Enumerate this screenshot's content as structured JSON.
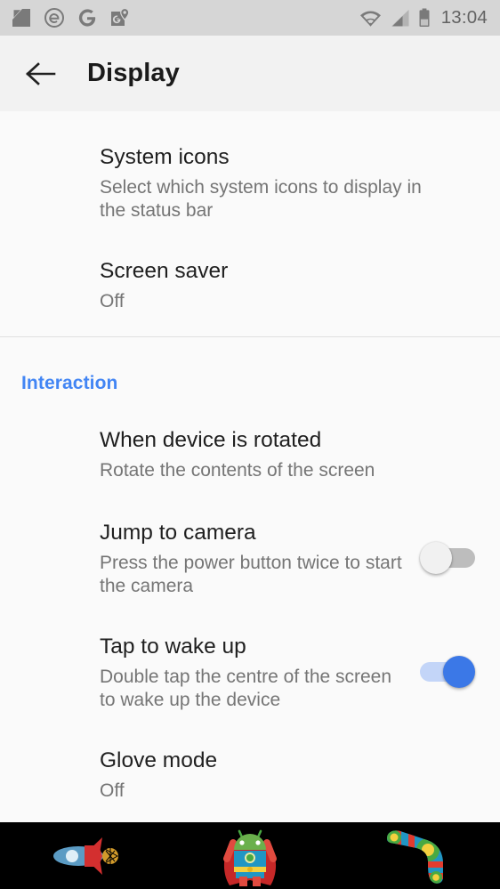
{
  "status_bar": {
    "notification_icons": [
      "screenshot-icon",
      "edge-browser-icon",
      "google-icon",
      "google-maps-icon"
    ],
    "wifi_icon": "wifi-icon",
    "signal_icon": "cellular-signal-icon",
    "battery_icon": "battery-icon",
    "time": "13:04",
    "background": "#d6d6d6",
    "icon_color": "#7a7a7a"
  },
  "app_bar": {
    "back_icon": "back-arrow-icon",
    "title": "Display",
    "background": "#f2f2f2"
  },
  "settings": {
    "section_1": {
      "items": [
        {
          "title": "System icons",
          "subtitle": "Select which system icons to display in the status bar",
          "has_toggle": false
        },
        {
          "title": "Screen saver",
          "subtitle": "Off",
          "has_toggle": false
        }
      ]
    },
    "section_2": {
      "header": "Interaction",
      "header_color": "#4285f4",
      "items": [
        {
          "title": "When device is rotated",
          "subtitle": "Rotate the contents of the screen",
          "has_toggle": false
        },
        {
          "title": "Jump to camera",
          "subtitle": "Press the power button twice to start the camera",
          "has_toggle": true,
          "toggle_state": "off"
        },
        {
          "title": "Tap to wake up",
          "subtitle": "Double tap the centre of the screen to wake up the device",
          "has_toggle": true,
          "toggle_state": "on"
        },
        {
          "title": "Glove mode",
          "subtitle": "Off",
          "has_toggle": false
        }
      ]
    }
  },
  "nav_bar": {
    "background": "#000000",
    "back_icon": "rocket-back-icon",
    "home_icon": "superhero-android-home-icon",
    "recents_icon": "boomerang-recents-icon"
  },
  "colors": {
    "accent_blue": "#4285f4",
    "toggle_on_knob": "#3b78e7",
    "toggle_on_track": "#c3d5f8",
    "toggle_off_knob": "#f1f1f1",
    "toggle_off_track": "#bdbdbd",
    "page_background": "#fafafa",
    "title_text": "#1f1f1f",
    "subtitle_text": "#757575"
  }
}
